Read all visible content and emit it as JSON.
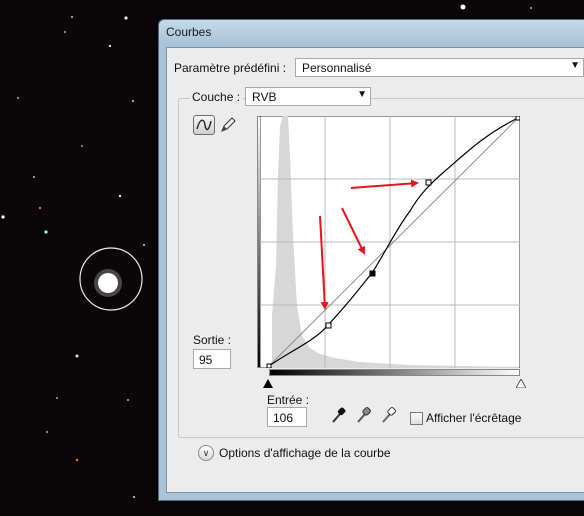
{
  "dialog": {
    "title": "Courbes",
    "preset_label": "Paramètre prédéfini :",
    "preset_value": "Personnalisé",
    "channel_label": "Couche :",
    "channel_value": "RVB",
    "output_label": "Sortie :",
    "output_value": "95",
    "input_label": "Entrée :",
    "input_value": "106",
    "clipping_label": "Afficher l'écrêtage",
    "curve_options_label": "Options d'affichage de la courbe"
  },
  "icons": {
    "curve_tool": "curve-icon",
    "pencil_tool": "pencil-icon",
    "black_point": "eyedropper-black-icon",
    "gray_point": "eyedropper-gray-icon",
    "white_point": "eyedropper-white-icon",
    "expand": "chevron-down-double-icon"
  },
  "colors": {
    "annotation_arrow": "#e5141b",
    "dialog_frame": "#a9c4d8",
    "panel": "#ececec"
  },
  "curve": {
    "points": [
      [
        0,
        0
      ],
      [
        60,
        47
      ],
      [
        106,
        95
      ],
      [
        165,
        182
      ],
      [
        255,
        255
      ]
    ],
    "selected_point": [
      106,
      95
    ],
    "grid_divisions": 4
  }
}
